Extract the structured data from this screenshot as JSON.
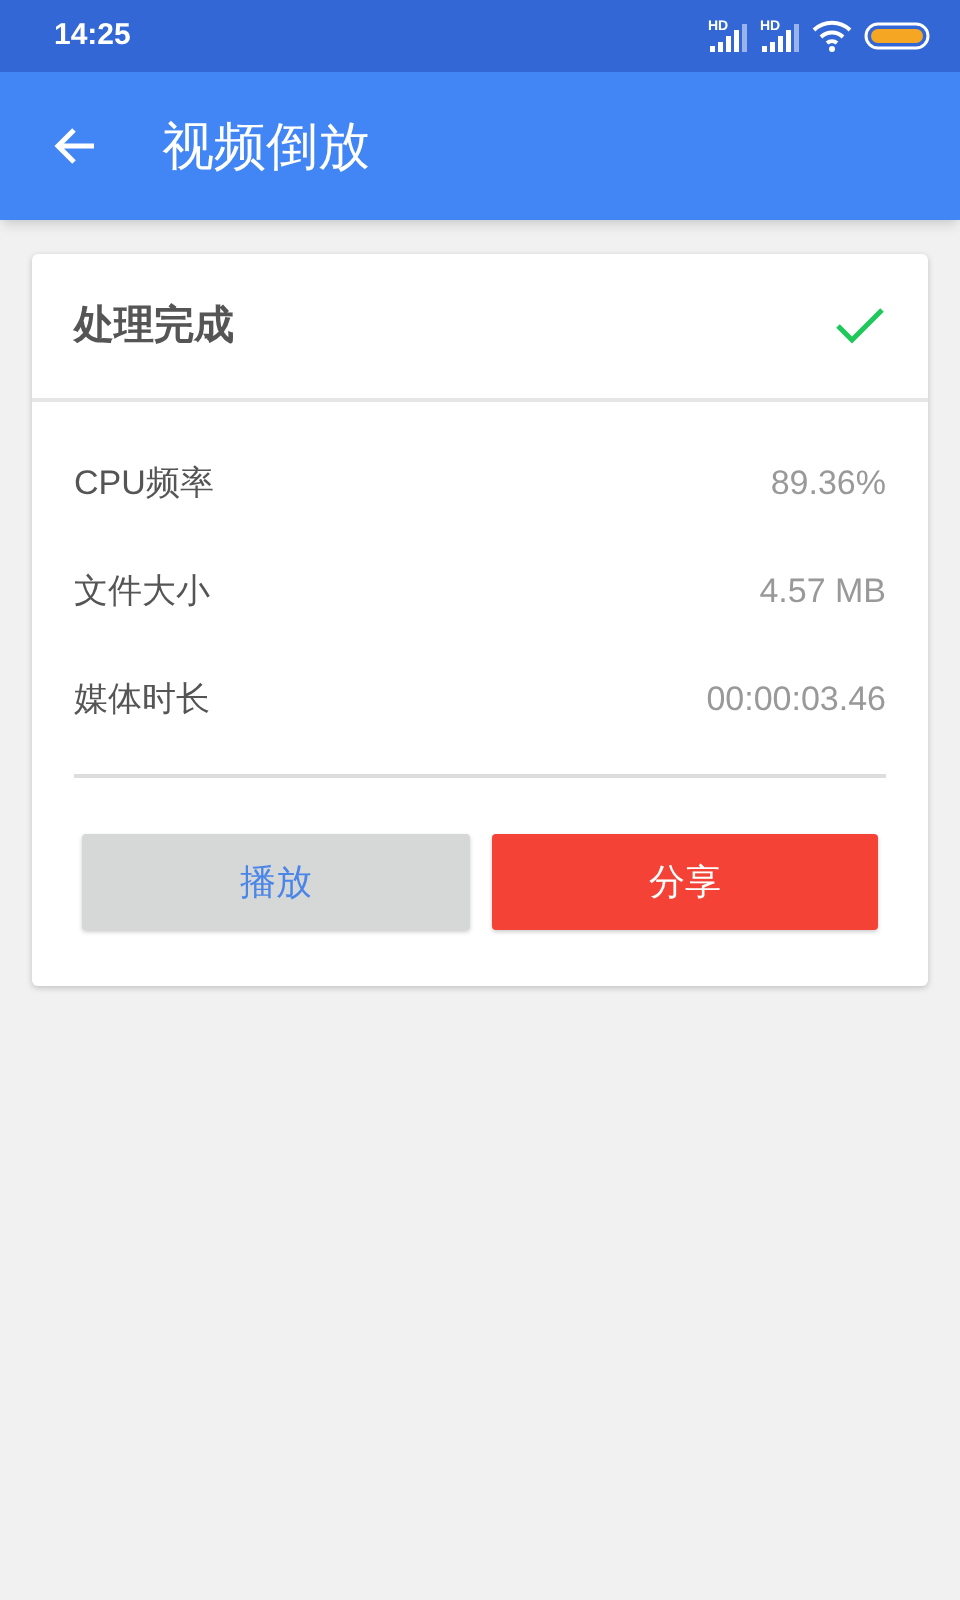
{
  "status_bar": {
    "time": "14:25",
    "signal_labels": [
      "HD",
      "HD"
    ]
  },
  "app_bar": {
    "title": "视频倒放"
  },
  "result_card": {
    "title": "处理完成",
    "details": [
      {
        "label": "CPU频率",
        "value": "89.36%"
      },
      {
        "label": "文件大小",
        "value": "4.57 MB"
      },
      {
        "label": "媒体时长",
        "value": "00:00:03.46"
      }
    ],
    "buttons": [
      {
        "label": "播放",
        "kind": "secondary"
      },
      {
        "label": "分享",
        "kind": "primary"
      }
    ]
  }
}
